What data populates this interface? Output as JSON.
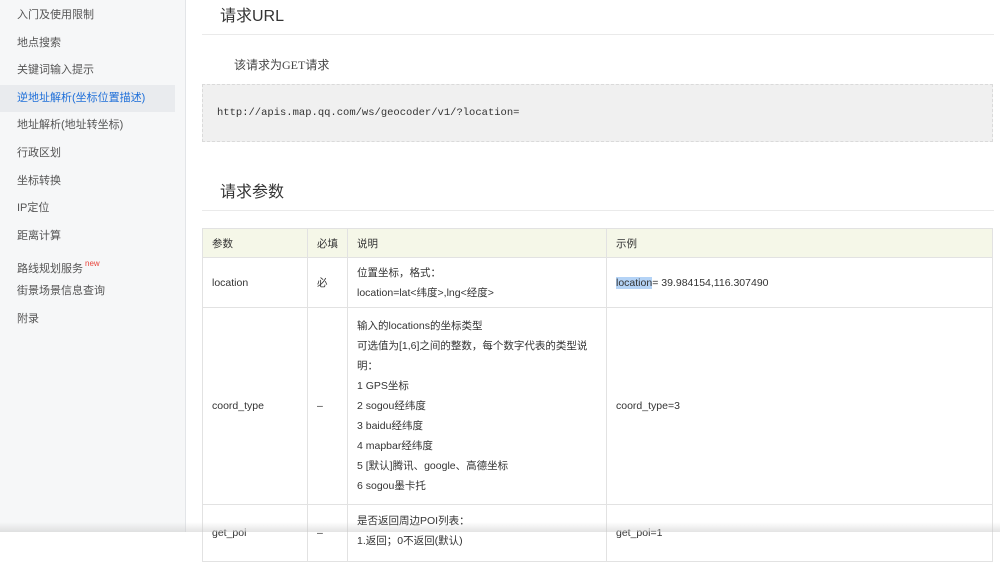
{
  "sidebar": {
    "items": [
      {
        "label": "入门及使用限制"
      },
      {
        "label": "地点搜索"
      },
      {
        "label": "关键词输入提示"
      },
      {
        "label": "逆地址解析(坐标位置描述)"
      },
      {
        "label": "地址解析(地址转坐标)"
      },
      {
        "label": "行政区划"
      },
      {
        "label": "坐标转换"
      },
      {
        "label": "IP定位"
      },
      {
        "label": "距离计算"
      },
      {
        "label": "路线规划服务",
        "badge": "new"
      },
      {
        "label": "街景场景信息查询"
      },
      {
        "label": "附录"
      }
    ],
    "active_index": 3
  },
  "request_url": {
    "heading": "请求URL",
    "description": "该请求为GET请求",
    "url": "http://apis.map.qq.com/ws/geocoder/v1/?location="
  },
  "params": {
    "heading": "请求参数",
    "headers": [
      "参数",
      "必填",
      "说明",
      "示例"
    ],
    "rows": [
      {
        "name": "location",
        "required": "必",
        "desc": [
          "位置坐标，格式：",
          "location=lat<纬度>,lng<经度>"
        ],
        "example_selected": "location",
        "example_rest": "= 39.984154,116.307490"
      },
      {
        "name": "coord_type",
        "required": "–",
        "desc": [
          "输入的locations的坐标类型",
          "可选值为[1,6]之间的整数，每个数字代表的类型说明：",
          "1 GPS坐标",
          "2 sogou经纬度",
          "3 baidu经纬度",
          "4 mapbar经纬度",
          "5 [默认]腾讯、google、高德坐标",
          "6 sogou墨卡托"
        ],
        "example": "coord_type=3"
      },
      {
        "name": "get_poi",
        "required": "–",
        "desc": [
          "是否返回周边POI列表：",
          "1.返回；0不返回(默认)"
        ],
        "example": "get_poi=1"
      }
    ]
  }
}
